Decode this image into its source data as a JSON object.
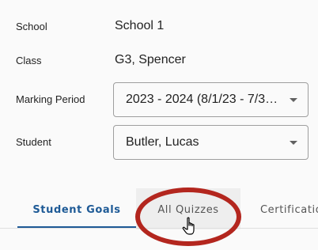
{
  "form": {
    "school_label": "School",
    "school_value": "School 1",
    "class_label": "Class",
    "class_value": "G3, Spencer",
    "marking_period_label": "Marking Period",
    "marking_period_value": "2023 - 2024 (8/1/23 - 7/3…",
    "student_label": "Student",
    "student_value": "Butler, Lucas"
  },
  "tabs": [
    {
      "label": "Student Goals",
      "state": "active"
    },
    {
      "label": "All Quizzes",
      "state": "hover"
    },
    {
      "label": "Certificatio",
      "state": "default"
    }
  ],
  "colors": {
    "tab_active": "#1e5a96",
    "annotation_circle": "#b3261e"
  },
  "icons": {
    "dropdown": "caret-down-icon",
    "pointer": "hand-pointer-icon"
  }
}
